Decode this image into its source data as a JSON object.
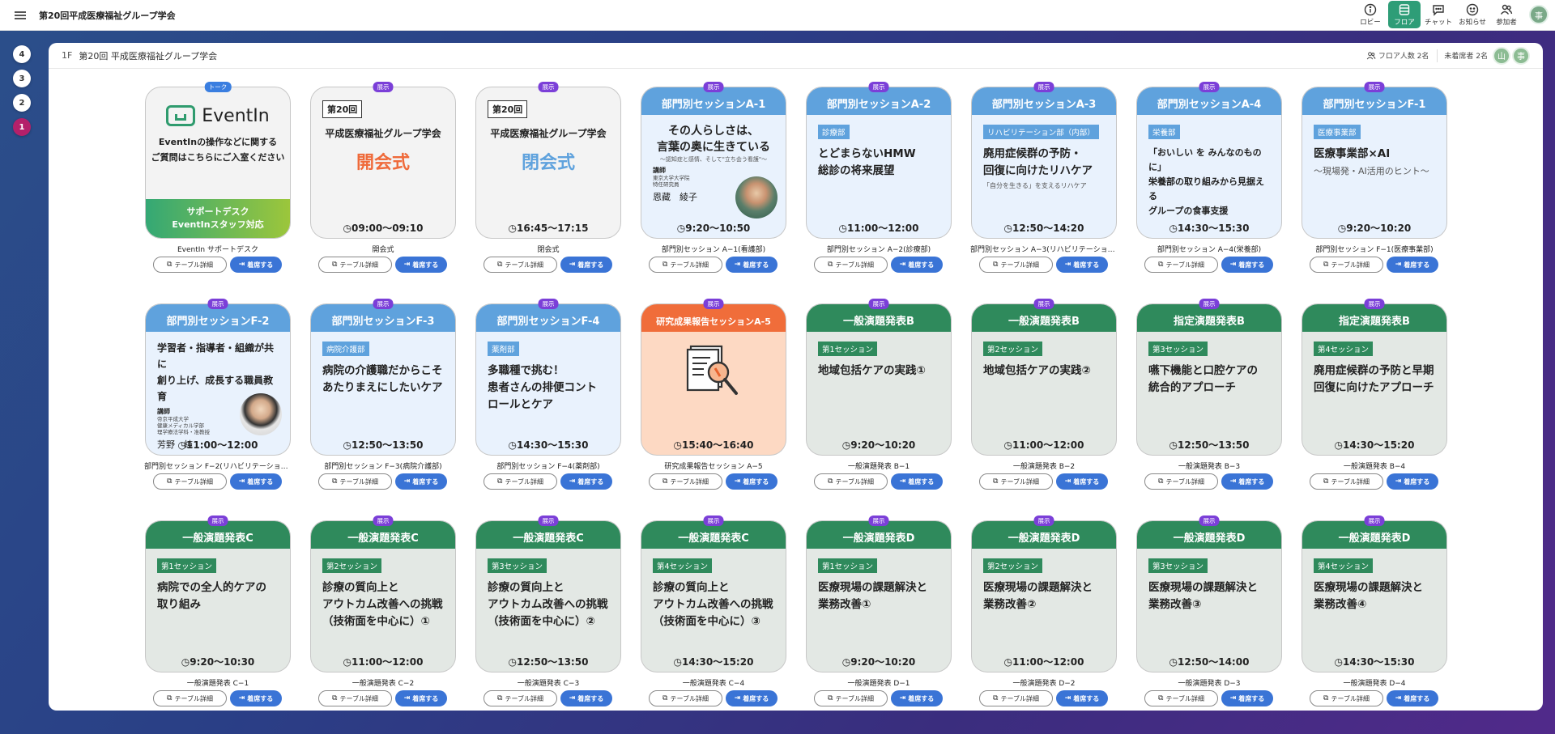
{
  "app": {
    "title": "第20回平成医療福祉グループ学会",
    "user_initial": "事"
  },
  "nav": [
    {
      "label": "ロビー",
      "icon": "info-icon"
    },
    {
      "label": "フロア",
      "icon": "floor-icon"
    },
    {
      "label": "チャット",
      "icon": "chat-icon"
    },
    {
      "label": "お知らせ",
      "icon": "smile-icon"
    },
    {
      "label": "参加者",
      "icon": "people-icon"
    }
  ],
  "floors": [
    "4",
    "3",
    "2",
    "1"
  ],
  "panel": {
    "floor": "1F",
    "title": "第20回 平成医療福祉グループ学会",
    "floor_count": "フロア人数 2名",
    "unseated": "未着席者 2名",
    "avatars": [
      "山",
      "事"
    ]
  },
  "buttons": {
    "detail": "テーブル詳細",
    "seat": "着席する"
  },
  "colors": {
    "accent_green": "#2e9d77",
    "seat_blue": "#3a74d6",
    "badge_purple": "#7b3fd8",
    "session_blue": "#5fa2dd",
    "session_green": "#2f8a5c",
    "research_orange": "#f06d3a",
    "active_floor": "#b4206a"
  },
  "cards": [
    {
      "kind": "support",
      "badge": "トーク",
      "logo": "EventIn",
      "desc1": "EventInの操作などに関する",
      "desc2": "ご質問はこちらにご入室ください",
      "foot1": "サポートデスク",
      "foot2": "EventInスタッフ対応",
      "name": "EventIn サポートデスク"
    },
    {
      "kind": "ceremony",
      "badge": "展示",
      "num": "第20回",
      "sub": "平成医療福祉グループ学会",
      "big": "開会式",
      "color": "red",
      "time": "09:00〜09:10",
      "name": "開会式"
    },
    {
      "kind": "ceremony",
      "badge": "展示",
      "num": "第20回",
      "sub": "平成医療福祉グループ学会",
      "big": "閉会式",
      "color": "blue",
      "time": "16:45〜17:15",
      "name": "閉会式"
    },
    {
      "kind": "speaker",
      "badge": "展示",
      "header": "部門別セッションA-1",
      "t1": "その人らしさは、",
      "t2": "言葉の奥に生きている",
      "small": "〜認知症と感情、そして\"立ち会う看護\"〜",
      "role": "講師",
      "aff1": "東京大学大学院",
      "aff2": "特任研究員",
      "aff3": "",
      "speaker": "恩藏　綾子",
      "photo": "woman",
      "time": "9:20〜10:50",
      "name": "部門別セッション A−1(看護部)"
    },
    {
      "kind": "tagged",
      "style": "blue",
      "badge": "展示",
      "header": "部門別セッションA-2",
      "tag": "診療部",
      "t1": "とどまらないHMW",
      "t2": "総診の将来展望",
      "t3": "",
      "sub": "",
      "time": "11:00〜12:00",
      "name": "部門別セッション A−2(診療部)"
    },
    {
      "kind": "tagged",
      "style": "blue",
      "badge": "展示",
      "header": "部門別セッションA-3",
      "tag": "リハビリテーション部（内部）",
      "t1": "廃用症候群の予防・",
      "t2": "回復に向けたリハケア",
      "t3": "",
      "sub": "「自分を生きる」を支えるリハケア",
      "time": "12:50〜14:20",
      "name": "部門別セッション A−3(リハビリテーション部)"
    },
    {
      "kind": "tagged",
      "style": "blue",
      "badge": "展示",
      "header": "部門別セッションA-4",
      "tag": "栄養部",
      "t1": "「おいしい を みんなのものに」",
      "t2": "栄養部の取り組みから見据える",
      "t3": "グループの食事支援",
      "sub": "",
      "small": true,
      "time": "14:30〜15:30",
      "name": "部門別セッション A−4(栄養部)"
    },
    {
      "kind": "tagged",
      "style": "blue",
      "badge": "展示",
      "header": "部門別セッションF-1",
      "tag": "医療事業部",
      "t1": "医療事業部×AI",
      "t2": "",
      "t3": "",
      "sub": "〜現場発・AI活用のヒント〜",
      "time": "9:20〜10:20",
      "name": "部門別セッション F−1(医療事業部)"
    },
    {
      "kind": "speaker",
      "badge": "展示",
      "header": "部門別セッションF-2",
      "t1": "学習者・指導者・組織が共に",
      "t2": "創り上げ、成長する職員教育",
      "small": "",
      "role": "講師",
      "aff1": "帝京平成大学",
      "aff2": "健康メディカル学部",
      "aff3": "理学療法学科・准教授",
      "speaker": "芳野　純",
      "photo": "man",
      "time": "11:00〜12:00",
      "name": "部門別セッション F−2(リハビリテーション部)"
    },
    {
      "kind": "tagged",
      "style": "blue",
      "badge": "展示",
      "header": "部門別セッションF-3",
      "tag": "病院介護部",
      "t1": "病院の介護職だからこそ",
      "t2": "あたりまえにしたいケア",
      "t3": "",
      "sub": "",
      "time": "12:50〜13:50",
      "name": "部門別セッション F−3(病院介護部)"
    },
    {
      "kind": "tagged",
      "style": "blue",
      "badge": "展示",
      "header": "部門別セッションF-4",
      "tag": "薬剤部",
      "t1": "多職種で挑む！",
      "t2": "患者さんの排便コント",
      "t3": "ロールとケア",
      "sub": "",
      "time": "14:30〜15:30",
      "name": "部門別セッション F−4(薬剤部)"
    },
    {
      "kind": "research",
      "badge": "展示",
      "header": "研究成果報告セッションA-5",
      "time": "15:40〜16:40",
      "name": "研究成果報告セッション A−5"
    },
    {
      "kind": "tagged",
      "style": "green",
      "badge": "展示",
      "header": "一般演題発表B",
      "tag": "第1セッション",
      "t1": "地域包括ケアの実践①",
      "t2": "",
      "t3": "",
      "sub": "",
      "time": "9:20〜10:20",
      "name": "一般演題発表 B−1"
    },
    {
      "kind": "tagged",
      "style": "green",
      "badge": "展示",
      "header": "一般演題発表B",
      "tag": "第2セッション",
      "t1": "地域包括ケアの実践②",
      "t2": "",
      "t3": "",
      "sub": "",
      "time": "11:00〜12:00",
      "name": "一般演題発表 B−2"
    },
    {
      "kind": "tagged",
      "style": "green",
      "badge": "展示",
      "header": "指定演題発表B",
      "tag": "第3セッション",
      "t1": "嚥下機能と口腔ケアの",
      "t2": "統合的アプローチ",
      "t3": "",
      "sub": "",
      "time": "12:50〜13:50",
      "name": "一般演題発表 B−3"
    },
    {
      "kind": "tagged",
      "style": "green",
      "badge": "展示",
      "header": "指定演題発表B",
      "tag": "第4セッション",
      "t1": "廃用症候群の予防と早期",
      "t2": "回復に向けたアプローチ",
      "t3": "",
      "sub": "",
      "time": "14:30〜15:20",
      "name": "一般演題発表 B−4"
    },
    {
      "kind": "tagged",
      "style": "green",
      "badge": "展示",
      "header": "一般演題発表C",
      "tag": "第1セッション",
      "t1": "病院での全人的ケアの",
      "t2": "取り組み",
      "t3": "",
      "sub": "",
      "time": "9:20〜10:30",
      "name": "一般演題発表 C−1"
    },
    {
      "kind": "tagged",
      "style": "green",
      "badge": "展示",
      "header": "一般演題発表C",
      "tag": "第2セッション",
      "t1": "診療の質向上と",
      "t2": "アウトカム改善への挑戦",
      "t3": "（技術面を中心に）①",
      "sub": "",
      "time": "11:00〜12:00",
      "name": "一般演題発表 C−2"
    },
    {
      "kind": "tagged",
      "style": "green",
      "badge": "展示",
      "header": "一般演題発表C",
      "tag": "第3セッション",
      "t1": "診療の質向上と",
      "t2": "アウトカム改善への挑戦",
      "t3": "（技術面を中心に）②",
      "sub": "",
      "time": "12:50〜13:50",
      "name": "一般演題発表 C−3"
    },
    {
      "kind": "tagged",
      "style": "green",
      "badge": "展示",
      "header": "一般演題発表C",
      "tag": "第4セッション",
      "t1": "診療の質向上と",
      "t2": "アウトカム改善への挑戦",
      "t3": "（技術面を中心に）③",
      "sub": "",
      "time": "14:30〜15:20",
      "name": "一般演題発表 C−4"
    },
    {
      "kind": "tagged",
      "style": "green",
      "badge": "展示",
      "header": "一般演題発表D",
      "tag": "第1セッション",
      "t1": "医療現場の課題解決と",
      "t2": "業務改善①",
      "t3": "",
      "sub": "",
      "time": "9:20〜10:20",
      "name": "一般演題発表 D−1"
    },
    {
      "kind": "tagged",
      "style": "green",
      "badge": "展示",
      "header": "一般演題発表D",
      "tag": "第2セッション",
      "t1": "医療現場の課題解決と",
      "t2": "業務改善②",
      "t3": "",
      "sub": "",
      "time": "11:00〜12:00",
      "name": "一般演題発表 D−2"
    },
    {
      "kind": "tagged",
      "style": "green",
      "badge": "展示",
      "header": "一般演題発表D",
      "tag": "第3セッション",
      "t1": "医療現場の課題解決と",
      "t2": "業務改善③",
      "t3": "",
      "sub": "",
      "time": "12:50〜14:00",
      "name": "一般演題発表 D−3"
    },
    {
      "kind": "tagged",
      "style": "green",
      "badge": "展示",
      "header": "一般演題発表D",
      "tag": "第4セッション",
      "t1": "医療現場の課題解決と",
      "t2": "業務改善④",
      "t3": "",
      "sub": "",
      "time": "14:30〜15:30",
      "name": "一般演題発表 D−4"
    }
  ]
}
